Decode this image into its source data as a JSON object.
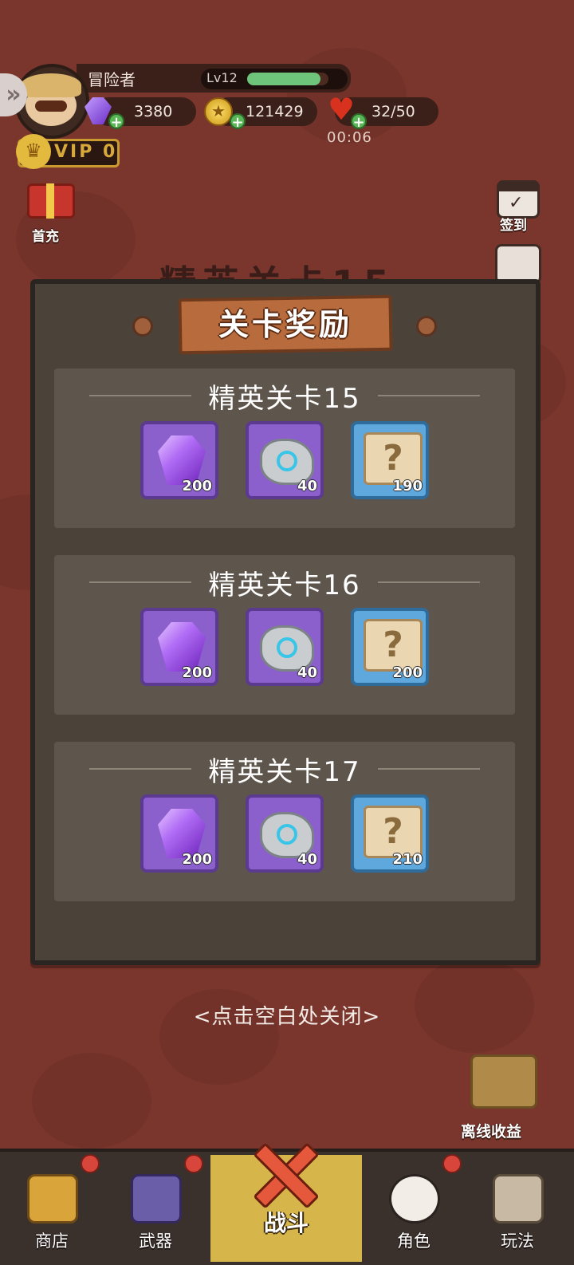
{
  "player": {
    "name": "冒险者",
    "level": "Lv12",
    "xp_progress": 0.9
  },
  "resources": {
    "gems": "3380",
    "coins": "121429",
    "stamina": "32/50",
    "stamina_timer": "00:06"
  },
  "vip": {
    "label": "VIP 0"
  },
  "side_left": {
    "first_charge": "首充"
  },
  "side_right": {
    "checkin": "签到"
  },
  "background_title": "精英关卡15",
  "dialog": {
    "title": "关卡奖励",
    "stages": [
      {
        "name": "精英关卡15",
        "rewards": [
          {
            "type": "gem-icon",
            "count": "200"
          },
          {
            "type": "stone-icon",
            "count": "40"
          },
          {
            "type": "scroll-icon",
            "count": "190"
          }
        ]
      },
      {
        "name": "精英关卡16",
        "rewards": [
          {
            "type": "gem-icon",
            "count": "200"
          },
          {
            "type": "stone-icon",
            "count": "40"
          },
          {
            "type": "scroll-icon",
            "count": "200"
          }
        ]
      },
      {
        "name": "精英关卡17",
        "rewards": [
          {
            "type": "gem-icon",
            "count": "200"
          },
          {
            "type": "stone-icon",
            "count": "40"
          },
          {
            "type": "scroll-icon",
            "count": "210"
          }
        ]
      }
    ],
    "close_hint": "<点击空白处关闭>"
  },
  "offline_income": "离线收益",
  "nav": {
    "shop": "商店",
    "weapons": "武器",
    "battle": "战斗",
    "character": "角色",
    "gameplay": "玩法"
  },
  "colors": {
    "background": "#7a362c",
    "panel": "#4b433a",
    "accent_gold": "#d6b64a",
    "item_purple": "#8b5fcc",
    "item_blue": "#5ea8de"
  }
}
